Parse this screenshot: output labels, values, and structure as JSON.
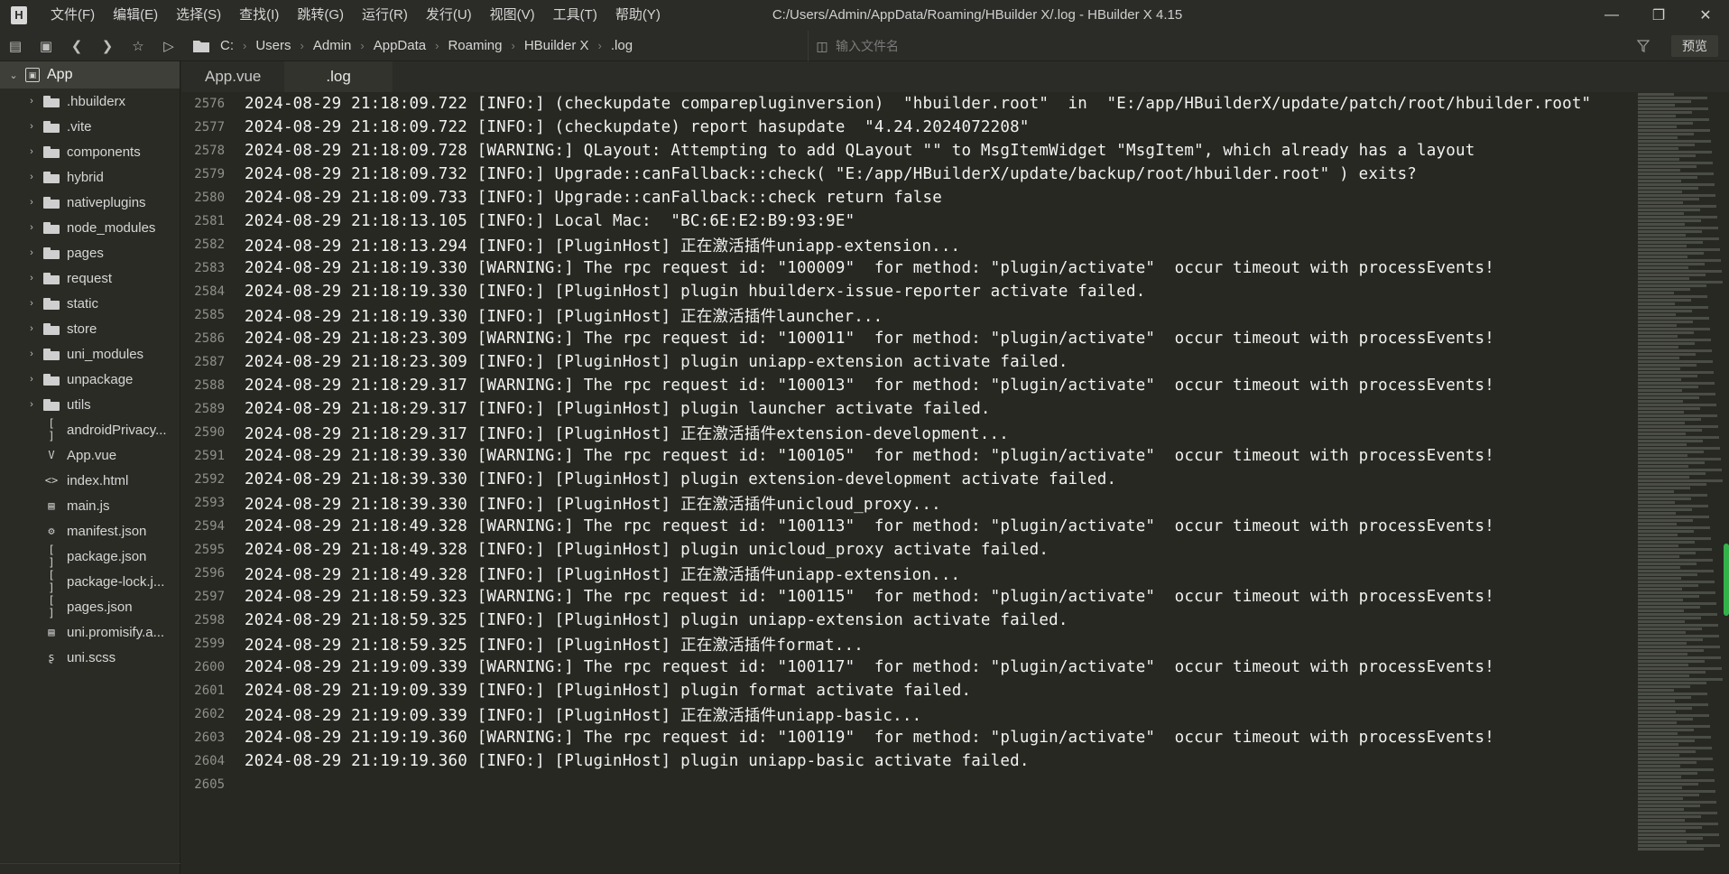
{
  "window": {
    "title": "C:/Users/Admin/AppData/Roaming/HBuilder X/.log - HBuilder X 4.15",
    "logo": "H"
  },
  "menu": [
    "文件(F)",
    "编辑(E)",
    "选择(S)",
    "查找(I)",
    "跳转(G)",
    "运行(R)",
    "发行(U)",
    "视图(V)",
    "工具(T)",
    "帮助(Y)"
  ],
  "toolbar": {
    "breadcrumb": [
      "C:",
      "Users",
      "Admin",
      "AppData",
      "Roaming",
      "HBuilder X",
      ".log"
    ],
    "search_placeholder": "输入文件名",
    "preview_label": "预览"
  },
  "sidebar": {
    "root": "App",
    "items": [
      {
        "label": ".hbuilderx",
        "type": "folder"
      },
      {
        "label": ".vite",
        "type": "folder"
      },
      {
        "label": "components",
        "type": "folder"
      },
      {
        "label": "hybrid",
        "type": "folder"
      },
      {
        "label": "nativeplugins",
        "type": "folder"
      },
      {
        "label": "node_modules",
        "type": "folder"
      },
      {
        "label": "pages",
        "type": "folder"
      },
      {
        "label": "request",
        "type": "folder"
      },
      {
        "label": "static",
        "type": "folder"
      },
      {
        "label": "store",
        "type": "folder"
      },
      {
        "label": "uni_modules",
        "type": "folder"
      },
      {
        "label": "unpackage",
        "type": "folder"
      },
      {
        "label": "utils",
        "type": "folder"
      },
      {
        "label": "androidPrivacy...",
        "type": "file",
        "glyph": "[ ]"
      },
      {
        "label": "App.vue",
        "type": "file",
        "glyph": "V"
      },
      {
        "label": "index.html",
        "type": "file",
        "glyph": "<>"
      },
      {
        "label": "main.js",
        "type": "file",
        "glyph": "▤"
      },
      {
        "label": "manifest.json",
        "type": "file",
        "glyph": "⚙"
      },
      {
        "label": "package.json",
        "type": "file",
        "glyph": "[ ]"
      },
      {
        "label": "package-lock.j...",
        "type": "file",
        "glyph": "[ ]"
      },
      {
        "label": "pages.json",
        "type": "file",
        "glyph": "[ ]"
      },
      {
        "label": "uni.promisify.a...",
        "type": "file",
        "glyph": "▤"
      },
      {
        "label": "uni.scss",
        "type": "file",
        "glyph": "ʂ"
      }
    ]
  },
  "tabs": [
    {
      "label": "App.vue",
      "active": false
    },
    {
      "label": ".log",
      "active": true
    }
  ],
  "editor": {
    "lines": [
      {
        "n": "2576",
        "text": "2024-08-29 21:18:09.722 [INFO:] (checkupdate comparepluginversion)  \"hbuilder.root\"  in  \"E:/app/HBuilderX/update/patch/root/hbuilder.root\""
      },
      {
        "n": "2577",
        "text": "2024-08-29 21:18:09.722 [INFO:] (checkupdate) report hasupdate  \"4.24.2024072208\""
      },
      {
        "n": "2578",
        "text": "2024-08-29 21:18:09.728 [WARNING:] QLayout: Attempting to add QLayout \"\" to MsgItemWidget \"MsgItem\", which already has a layout"
      },
      {
        "n": "2579",
        "text": "2024-08-29 21:18:09.732 [INFO:] Upgrade::canFallback::check( \"E:/app/HBuilderX/update/backup/root/hbuilder.root\" ) exits?"
      },
      {
        "n": "2580",
        "text": "2024-08-29 21:18:09.733 [INFO:] Upgrade::canFallback::check return false"
      },
      {
        "n": "2581",
        "text": "2024-08-29 21:18:13.105 [INFO:] Local Mac:  \"BC:6E:E2:B9:93:9E\""
      },
      {
        "n": "2582",
        "text": "2024-08-29 21:18:13.294 [INFO:] [PluginHost] 正在激活插件uniapp-extension..."
      },
      {
        "n": "2583",
        "text": "2024-08-29 21:18:19.330 [WARNING:] The rpc request id: \"100009\"  for method: \"plugin/activate\"  occur timeout with processEvents!"
      },
      {
        "n": "2584",
        "text": "2024-08-29 21:18:19.330 [INFO:] [PluginHost] plugin hbuilderx-issue-reporter activate failed."
      },
      {
        "n": "2585",
        "text": "2024-08-29 21:18:19.330 [INFO:] [PluginHost] 正在激活插件launcher..."
      },
      {
        "n": "2586",
        "text": "2024-08-29 21:18:23.309 [WARNING:] The rpc request id: \"100011\"  for method: \"plugin/activate\"  occur timeout with processEvents!"
      },
      {
        "n": "2587",
        "text": "2024-08-29 21:18:23.309 [INFO:] [PluginHost] plugin uniapp-extension activate failed."
      },
      {
        "n": "2588",
        "text": "2024-08-29 21:18:29.317 [WARNING:] The rpc request id: \"100013\"  for method: \"plugin/activate\"  occur timeout with processEvents!"
      },
      {
        "n": "2589",
        "text": "2024-08-29 21:18:29.317 [INFO:] [PluginHost] plugin launcher activate failed."
      },
      {
        "n": "2590",
        "text": "2024-08-29 21:18:29.317 [INFO:] [PluginHost] 正在激活插件extension-development..."
      },
      {
        "n": "2591",
        "text": "2024-08-29 21:18:39.330 [WARNING:] The rpc request id: \"100105\"  for method: \"plugin/activate\"  occur timeout with processEvents!"
      },
      {
        "n": "2592",
        "text": "2024-08-29 21:18:39.330 [INFO:] [PluginHost] plugin extension-development activate failed."
      },
      {
        "n": "2593",
        "text": "2024-08-29 21:18:39.330 [INFO:] [PluginHost] 正在激活插件unicloud_proxy..."
      },
      {
        "n": "2594",
        "text": "2024-08-29 21:18:49.328 [WARNING:] The rpc request id: \"100113\"  for method: \"plugin/activate\"  occur timeout with processEvents!"
      },
      {
        "n": "2595",
        "text": "2024-08-29 21:18:49.328 [INFO:] [PluginHost] plugin unicloud_proxy activate failed."
      },
      {
        "n": "2596",
        "text": "2024-08-29 21:18:49.328 [INFO:] [PluginHost] 正在激活插件uniapp-extension..."
      },
      {
        "n": "2597",
        "text": "2024-08-29 21:18:59.323 [WARNING:] The rpc request id: \"100115\"  for method: \"plugin/activate\"  occur timeout with processEvents!"
      },
      {
        "n": "2598",
        "text": "2024-08-29 21:18:59.325 [INFO:] [PluginHost] plugin uniapp-extension activate failed."
      },
      {
        "n": "2599",
        "text": "2024-08-29 21:18:59.325 [INFO:] [PluginHost] 正在激活插件format..."
      },
      {
        "n": "2600",
        "text": "2024-08-29 21:19:09.339 [WARNING:] The rpc request id: \"100117\"  for method: \"plugin/activate\"  occur timeout with processEvents!"
      },
      {
        "n": "2601",
        "text": "2024-08-29 21:19:09.339 [INFO:] [PluginHost] plugin format activate failed."
      },
      {
        "n": "2602",
        "text": "2024-08-29 21:19:09.339 [INFO:] [PluginHost] 正在激活插件uniapp-basic..."
      },
      {
        "n": "2603",
        "text": "2024-08-29 21:19:19.360 [WARNING:] The rpc request id: \"100119\"  for method: \"plugin/activate\"  occur timeout with processEvents!"
      },
      {
        "n": "2604",
        "text": "2024-08-29 21:19:19.360 [INFO:] [PluginHost] plugin uniapp-basic activate failed."
      },
      {
        "n": "2605",
        "text": ""
      }
    ]
  },
  "colors": {
    "background": "#272822",
    "sidebar": "#2a2b25",
    "minimap_thumb": "#34b24a"
  }
}
